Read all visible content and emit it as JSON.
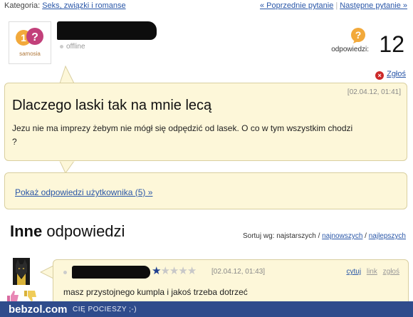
{
  "topbar": {
    "category_label": "Kategoria:",
    "category_link": "Seks, związki i romanse",
    "prev_link": "« Poprzednie pytanie",
    "next_link": "Następne pytanie »",
    "separator": "|"
  },
  "author": {
    "logo_text": "samosia",
    "status": "offline"
  },
  "answers": {
    "label": "odpowiedzi:",
    "count": "12"
  },
  "report": {
    "label": "Zgłoś"
  },
  "question": {
    "date": "[02.04.12, 01:41]",
    "title": "Dlaczego laski tak na mnie lecą",
    "body": "Jezu nie ma imprezy żebym nie mógł się odpędzić od lasek. O co w tym wszystkim chodzi ?"
  },
  "user_answers_link": "Pokaż odpowiedzi użytkownika (5) »",
  "other": {
    "title_bold": "Inne",
    "title_rest": " odpowiedzi",
    "sort_label": "Sortuj wg: najstarszych /",
    "sort_newest": "najnowszych",
    "sort_sep": "/",
    "sort_best": "najlepszych"
  },
  "answer1": {
    "rating": 1,
    "rating_max": 5,
    "date": "[02.04.12, 01:43]",
    "quote": "cytuj",
    "link": "link",
    "report": "zgłoś",
    "text": "masz przystojnego kumpla i jakoś trzeba dotrzeć"
  },
  "footer": {
    "brand": "bebzol.com",
    "tagline": "CIĘ POCIESZY ;-)"
  },
  "colors": {
    "link": "#2a57a8",
    "box_bg": "#fdf7d9",
    "box_border": "#d9cfa0",
    "footer_bg": "#2f4c8c",
    "star_on": "#1f3f8f"
  },
  "icons": [
    "question-bubble-icon",
    "report-x-icon",
    "star-icon",
    "thumb-up-icon",
    "thumb-down-icon"
  ]
}
